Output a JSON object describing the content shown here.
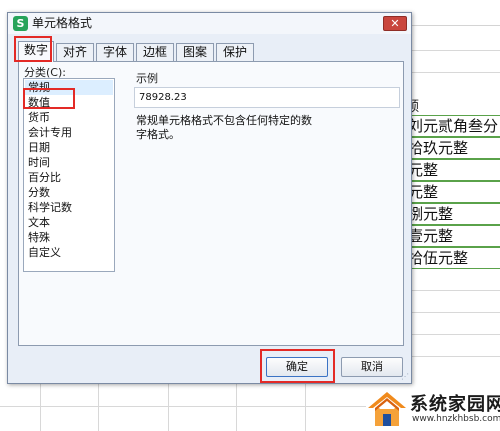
{
  "sheet": {
    "header_cell": "额",
    "cells": [
      "刘元贰角叁分",
      "拾玖元整",
      "元整",
      "元整",
      "捌元整",
      "壹元整",
      "拾伍元整"
    ]
  },
  "dialog": {
    "title": "单元格格式",
    "app_icon_letter": "S",
    "close_symbol": "✕",
    "tabs": [
      {
        "label": "数字",
        "active": true
      },
      {
        "label": "对齐",
        "active": false
      },
      {
        "label": "字体",
        "active": false
      },
      {
        "label": "边框",
        "active": false
      },
      {
        "label": "图案",
        "active": false
      },
      {
        "label": "保护",
        "active": false
      }
    ],
    "category_label": "分类(C):",
    "categories": [
      "常规",
      "数值",
      "货币",
      "会计专用",
      "日期",
      "时间",
      "百分比",
      "分数",
      "科学记数",
      "文本",
      "特殊",
      "自定义"
    ],
    "selected_category": "常规",
    "sample_label": "示例",
    "sample_value": "78928.23",
    "description": "常规单元格格式不包含任何特定的数字格式。",
    "ok_label": "确定",
    "cancel_label": "取消"
  },
  "watermark": {
    "name": "系统家园网",
    "url": "www.hnzkhbsb.com"
  },
  "colors": {
    "highlight": "#e32a26",
    "cell_border": "#5aa24a",
    "app_icon": "#27a35a",
    "close_button": "#c9463d"
  }
}
